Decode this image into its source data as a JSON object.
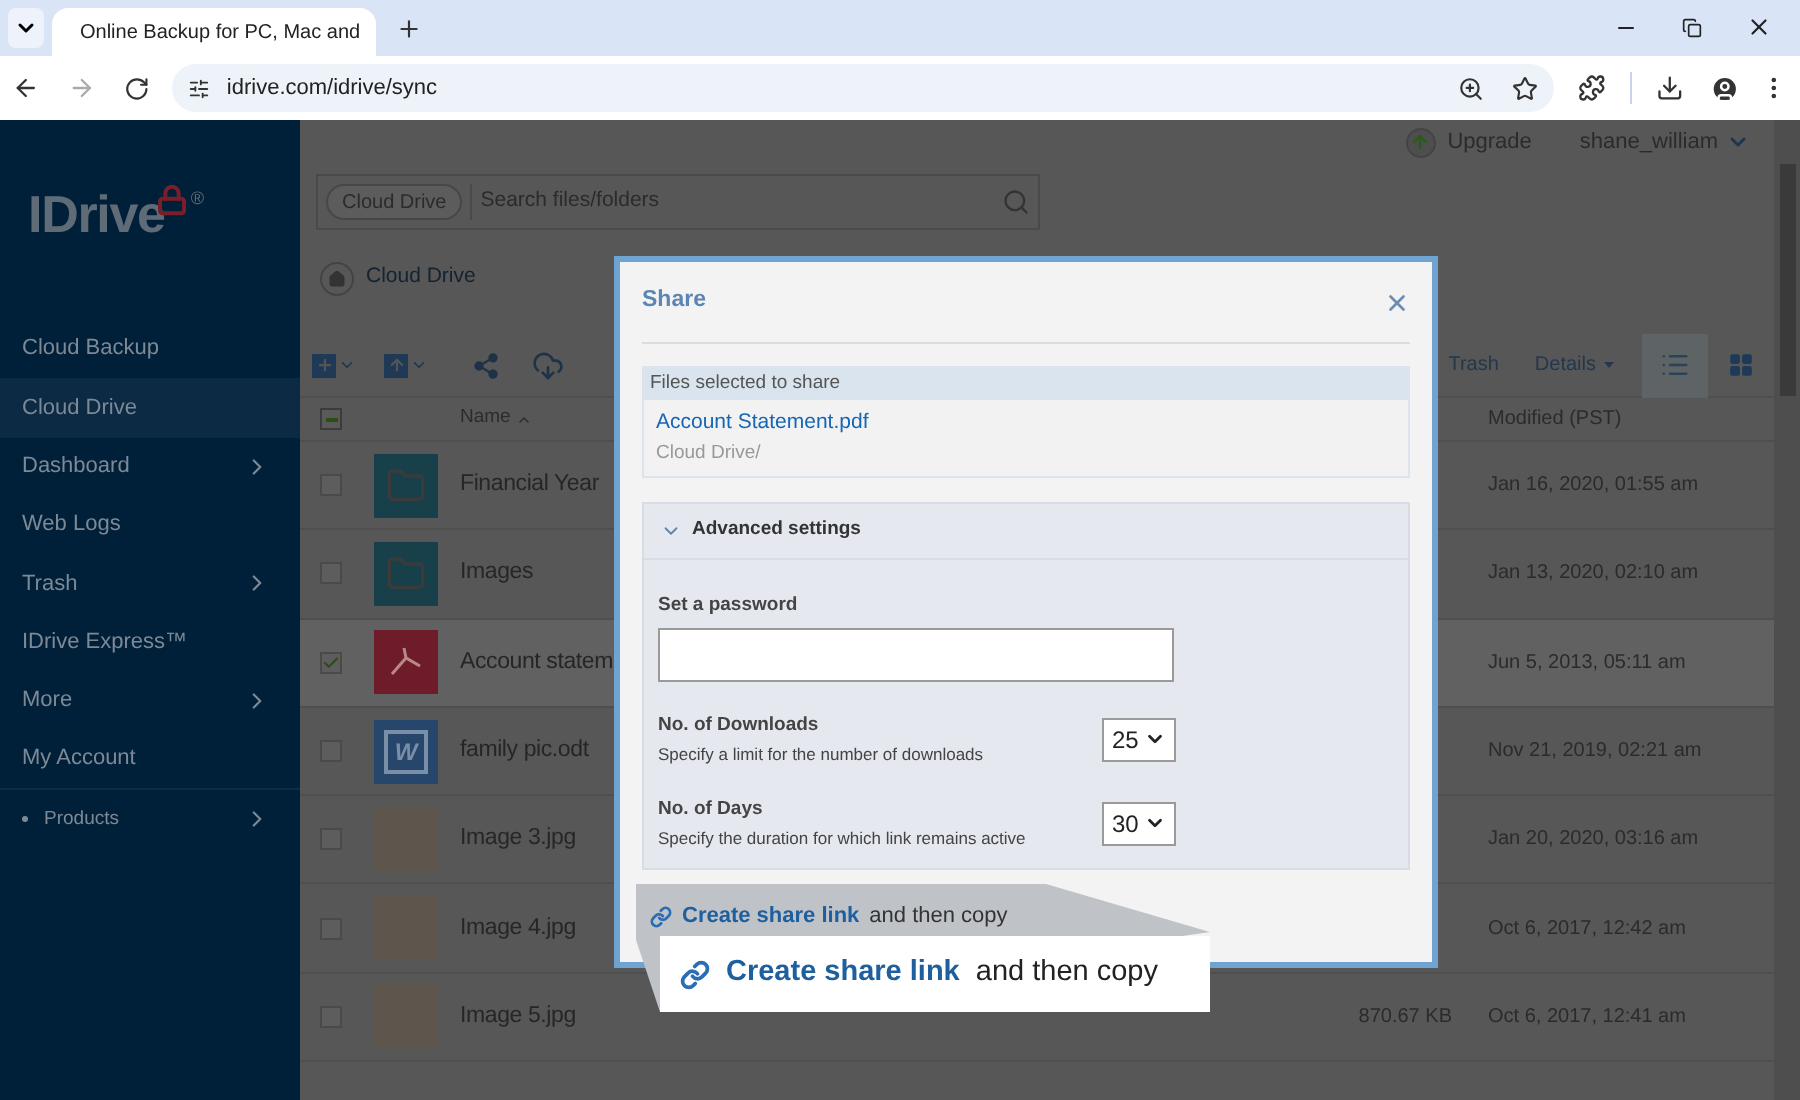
{
  "browser": {
    "tab_title": "Online Backup for PC, Mac and",
    "url": "idrive.com/idrive/sync",
    "forward_disabled": true
  },
  "sidebar": {
    "logo": "IDrive",
    "logo_mark": "®",
    "items": [
      {
        "label": "Cloud Backup",
        "selected": false,
        "has_submenu": false,
        "kind": "main"
      },
      {
        "label": "Cloud Drive",
        "selected": true,
        "has_submenu": false,
        "kind": "main"
      },
      {
        "label": "Dashboard",
        "selected": false,
        "has_submenu": true,
        "kind": "main"
      },
      {
        "label": "Web Logs",
        "selected": false,
        "has_submenu": false,
        "kind": "main"
      },
      {
        "label": "Trash",
        "selected": false,
        "has_submenu": true,
        "kind": "main"
      },
      {
        "label": "IDrive Express™",
        "selected": false,
        "has_submenu": false,
        "kind": "main"
      },
      {
        "label": "More",
        "selected": false,
        "has_submenu": true,
        "kind": "main"
      },
      {
        "label": "My Account",
        "selected": false,
        "has_submenu": false,
        "kind": "main"
      },
      {
        "label": "Products",
        "selected": false,
        "has_submenu": true,
        "kind": "small"
      }
    ]
  },
  "topbar": {
    "upgrade": "Upgrade",
    "user": "shane_william"
  },
  "search": {
    "scope": "Cloud Drive",
    "placeholder": "Search files/folders"
  },
  "breadcrumb": "Cloud Drive",
  "toolbar": {
    "trash": "Trash",
    "details": "Details",
    "list_view_selected": true
  },
  "table": {
    "select_all_partial": true,
    "columns": [
      "Name",
      "Modified (PST)"
    ],
    "rows": [
      {
        "name": "Financial Year",
        "kind": "folder",
        "checked": false,
        "modified": "Jan 16, 2020, 01:55 am"
      },
      {
        "name": "Images",
        "kind": "folder",
        "checked": false,
        "modified": "Jan 13, 2020, 02:10 am"
      },
      {
        "name": "Account statem",
        "kind": "pdf",
        "checked": true,
        "modified": "Jun 5, 2013, 05:11 am"
      },
      {
        "name": "family pic.odt",
        "kind": "doc",
        "icon_letter": "W",
        "checked": false,
        "modified": "Nov 21, 2019, 02:21 am"
      },
      {
        "name": "Image 3.jpg",
        "kind": "image",
        "checked": false,
        "modified": "Jan 20, 2020, 03:16 am"
      },
      {
        "name": "Image 4.jpg",
        "kind": "image",
        "checked": false,
        "modified": "Oct 6, 2017, 12:42 am"
      },
      {
        "name": "Image 5.jpg",
        "kind": "image",
        "checked": false,
        "size": "870.67 KB",
        "modified": "Oct 6, 2017, 12:41 am"
      }
    ]
  },
  "share_dialog": {
    "title": "Share",
    "files_header": "Files selected to share",
    "file_name": "Account Statement.pdf",
    "file_path": "Cloud Drive/",
    "advanced": {
      "label": "Advanced settings",
      "expanded": true
    },
    "password_label": "Set a password",
    "downloads": {
      "label": "No. of Downloads",
      "hint": "Specify a limit for the number of downloads",
      "value": "25"
    },
    "days": {
      "label": "No. of Days",
      "hint": "Specify the duration for which link remains active",
      "value": "30"
    },
    "link": {
      "link": "Create share link",
      "rest": "and then copy"
    }
  },
  "callout": {
    "link": "Create share link",
    "rest": "and then copy"
  }
}
